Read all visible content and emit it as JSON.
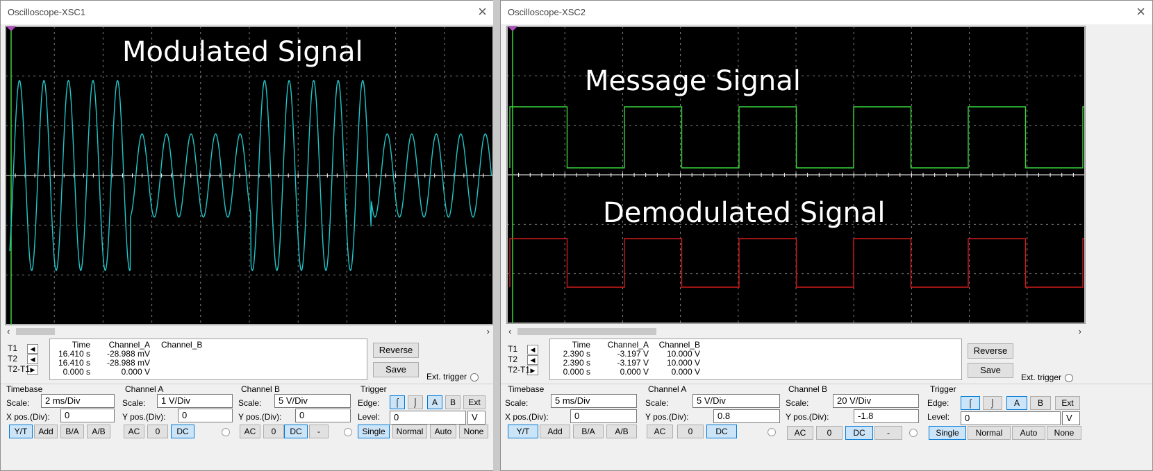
{
  "xsc1": {
    "title": "Oscilloscope-XSC1",
    "overlay_text": "Modulated Signal",
    "cursor_labels": [
      "T1",
      "T2",
      "T2-T1"
    ],
    "readout": {
      "headers": [
        "Time",
        "Channel_A",
        "Channel_B"
      ],
      "rows": [
        [
          "16.410 s",
          "-28.988 mV",
          ""
        ],
        [
          "16.410 s",
          "-28.988 mV",
          ""
        ],
        [
          "0.000 s",
          "0.000 V",
          ""
        ]
      ]
    },
    "reverse_label": "Reverse",
    "save_label": "Save",
    "ext_trigger_label": "Ext. trigger",
    "timebase": {
      "title": "Timebase",
      "scale_label": "Scale:",
      "scale_value": "2 ms/Div",
      "pos_label": "X pos.(Div):",
      "pos_value": "0",
      "buttons": [
        "Y/T",
        "Add",
        "B/A",
        "A/B"
      ],
      "active": "Y/T"
    },
    "channel_a": {
      "title": "Channel A",
      "scale_label": "Scale:",
      "scale_value": "1  V/Div",
      "pos_label": "Y pos.(Div):",
      "pos_value": "0",
      "buttons": [
        "AC",
        "0",
        "DC"
      ],
      "active": "DC"
    },
    "channel_b": {
      "title": "Channel B",
      "scale_label": "Scale:",
      "scale_value": "5  V/Div",
      "pos_label": "Y pos.(Div):",
      "pos_value": "0",
      "buttons": [
        "AC",
        "0",
        "DC",
        "-"
      ],
      "active": "DC"
    },
    "trigger": {
      "title": "Trigger",
      "edge_label": "Edge:",
      "edge_rise": "⌠",
      "edge_fall": "⌡",
      "sources": [
        "A",
        "B",
        "Ext"
      ],
      "active_source": "A",
      "level_label": "Level:",
      "level_value": "0",
      "level_unit": "V",
      "modes": [
        "Single",
        "Normal",
        "Auto",
        "None"
      ],
      "active_mode": "Single"
    },
    "trace_color": "#21c6c9"
  },
  "xsc2": {
    "title": "Oscilloscope-XSC2",
    "overlay_text_1": "Message Signal",
    "overlay_text_2": "Demodulated Signal",
    "cursor_labels": [
      "T1",
      "T2",
      "T2-T1"
    ],
    "readout": {
      "headers": [
        "Time",
        "Channel_A",
        "Channel_B"
      ],
      "rows": [
        [
          "2.390 s",
          "-3.197 V",
          "10.000 V"
        ],
        [
          "2.390 s",
          "-3.197 V",
          "10.000 V"
        ],
        [
          "0.000 s",
          "0.000 V",
          "0.000 V"
        ]
      ]
    },
    "reverse_label": "Reverse",
    "save_label": "Save",
    "ext_trigger_label": "Ext. trigger",
    "timebase": {
      "title": "Timebase",
      "scale_label": "Scale:",
      "scale_value": "5 ms/Div",
      "pos_label": "X pos.(Div):",
      "pos_value": "0",
      "buttons": [
        "Y/T",
        "Add",
        "B/A",
        "A/B"
      ],
      "active": "Y/T"
    },
    "channel_a": {
      "title": "Channel A",
      "scale_label": "Scale:",
      "scale_value": "5  V/Div",
      "pos_label": "Y pos.(Div):",
      "pos_value": "0.8",
      "buttons": [
        "AC",
        "0",
        "DC"
      ],
      "active": "DC"
    },
    "channel_b": {
      "title": "Channel B",
      "scale_label": "Scale:",
      "scale_value": "20  V/Div",
      "pos_label": "Y pos.(Div):",
      "pos_value": "-1.8",
      "buttons": [
        "AC",
        "0",
        "DC",
        "-"
      ],
      "active": "DC"
    },
    "trigger": {
      "title": "Trigger",
      "edge_label": "Edge:",
      "edge_rise": "⌠",
      "edge_fall": "⌡",
      "sources": [
        "A",
        "B",
        "Ext"
      ],
      "active_source": "A",
      "level_label": "Level:",
      "level_value": "0",
      "level_unit": "V",
      "modes": [
        "Single",
        "Normal",
        "Auto",
        "None"
      ],
      "active_mode": "Single"
    },
    "trace_a_color": "#39d53c",
    "trace_b_color": "#d11a1a"
  }
}
